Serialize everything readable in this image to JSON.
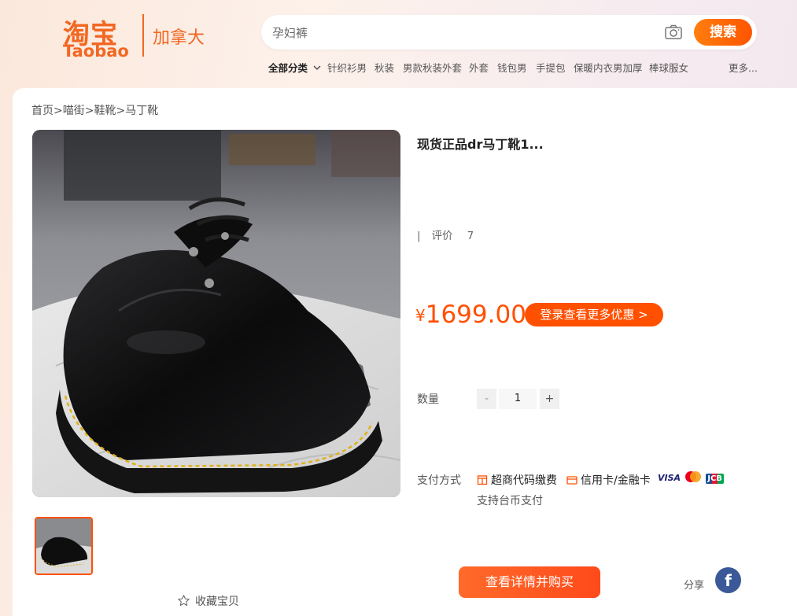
{
  "header": {
    "logo_cn": "淘宝",
    "logo_en": "Taobao",
    "region": "加拿大",
    "search_placeholder": "孕妇裤",
    "search_button": "搜索",
    "camera_icon": "camera-icon"
  },
  "nav": {
    "all_categories": "全部分类",
    "items": [
      "针织衫男",
      "秋装",
      "男款秋装外套",
      "外套",
      "钱包男",
      "手提包",
      "保暖内衣男加厚",
      "棒球服女"
    ],
    "more": "更多..."
  },
  "breadcrumb": [
    "首页",
    "喵街",
    "鞋靴",
    "马丁靴"
  ],
  "product": {
    "title": "现货正品dr马丁靴1...",
    "review_label": "评价",
    "review_count": "7",
    "currency": "¥",
    "price": "1699.00",
    "promo_button": "登录查看更多优惠 >",
    "image_desc_icon": "product-photo"
  },
  "quantity": {
    "label": "数量",
    "minus": "-",
    "value": "1",
    "plus": "+"
  },
  "payment": {
    "label": "支付方式",
    "option1": "超商代码缴费",
    "option2": "信用卡/金融卡",
    "visa": "VISA",
    "jcb": "JCB",
    "note": "支持台币支付"
  },
  "actions": {
    "favorite": "收藏宝贝",
    "buy_button": "查看详情并购买",
    "share_label": "分享",
    "facebook": "f"
  },
  "colors": {
    "brand": "#f26722",
    "accent": "#ff5000",
    "facebook": "#3b5998"
  }
}
